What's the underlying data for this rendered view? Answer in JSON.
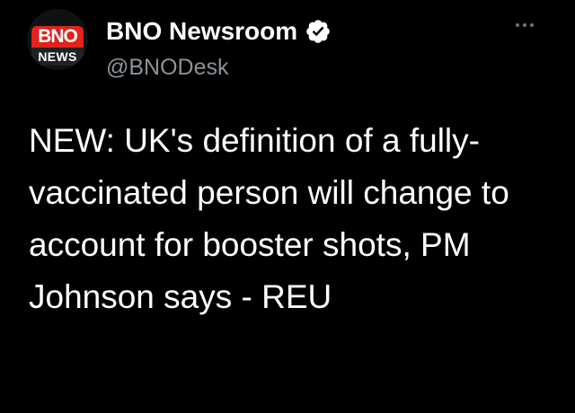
{
  "author": {
    "display_name": "BNO Newsroom",
    "handle": "@BNODesk",
    "verified": true,
    "avatar": {
      "line1": "BNO",
      "line2": "NEWS",
      "accent_color": "#e3221b",
      "dark_color": "#1f2126"
    }
  },
  "menu": {
    "icon": "more-horizontal-icon"
  },
  "tweet": {
    "text": "NEW: UK's definition of a fully-vaccinated person will change to account for booster shots, PM Johnson says - REU"
  },
  "colors": {
    "background": "#000000",
    "primary_text": "#ffffff",
    "secondary_text": "#8b9298"
  }
}
